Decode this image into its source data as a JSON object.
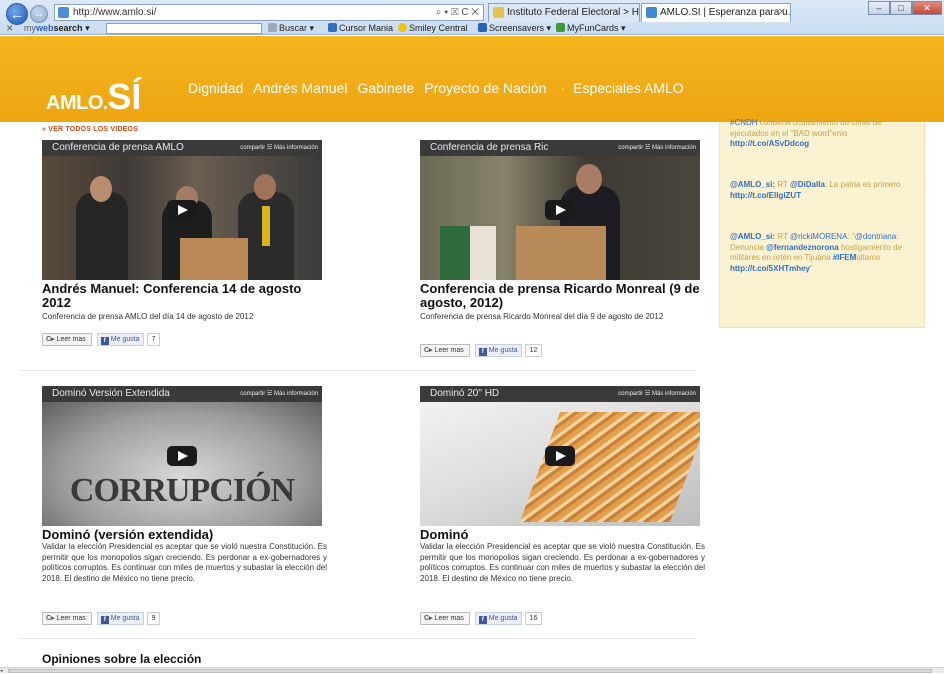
{
  "browser": {
    "address": "http://www.amlo.si/",
    "address_controls": "⌕ ▾ ☒ C ✕",
    "tabs": [
      {
        "label": "Instituto Federal Electoral > Ho...",
        "active": false,
        "icon_color": "#e7c24a"
      },
      {
        "label": "AMLO.SI | Esperanza para u...",
        "active": true,
        "icon_color": "#3f88d4"
      }
    ],
    "tab_close": "✕",
    "window_controls": {
      "minimize": "–",
      "maximize": "□",
      "close": "✕"
    },
    "back_icon": "←",
    "forward_icon": "→",
    "home_star": "⌂ ☆"
  },
  "toolbar": {
    "close_x": "✕",
    "brand_my": "my",
    "brand_web": "web",
    "brand_search": "search",
    "brand_caret": "▾",
    "buscar": "Buscar",
    "cursor_mania": "Cursor Mania",
    "smiley_central": "Smiley Central",
    "screensavers": "Screensavers",
    "myfuncards": "MyFunCards",
    "caret": "▾"
  },
  "header": {
    "logo_text": "AMLO",
    "logo_dot": ".",
    "logo_si": "SÍ",
    "nav": [
      "Dignidad",
      "Andrés Manuel",
      "Gabinete",
      "Proyecto de Nación"
    ],
    "nav_sep": "·",
    "nav_special": "Especiales AMLO",
    "color": "#f0a816"
  },
  "main": {
    "ver_todos": "» VER TODOS LOS VIDEOS",
    "share_label": "compartir",
    "share_icon": "☱",
    "more_info": "Más información",
    "leer_mas": "Leer mas",
    "leer_icon": "C▸",
    "me_gusta": "Me gusta",
    "fb_f": "f",
    "videos": [
      {
        "video_title": "Conferencia de prensa AMLO",
        "title": "Andrés Manuel: Conferencia 14 de agosto 2012",
        "desc": "Conferencia de prensa AMLO del día 14 de agosto de 2012",
        "likes": "7"
      },
      {
        "video_title": "Conferencia de prensa Ric",
        "title": "Conferencia de prensa Ricardo Monreal (9 de agosto, 2012)",
        "desc": "Conferencia de prensa Ricardo Monreal del día 9 de agosto de 2012",
        "likes": "12"
      },
      {
        "video_title": "Dominó Versión Extendida",
        "scene_text": "CORRUPCIÓN",
        "title": "Dominó (versión extendida)",
        "desc": "Validar la elección Presidencial es aceptar que se violó nuestra Constitución. Es permitir que los monopolios sigan creciendo. Es perdonar a ex-gobernadores y políticos corruptos. Es continuar con miles de muertos y subastar la elección del 2018. El destino de México no tiene precio.",
        "likes": "9"
      },
      {
        "video_title": "Dominó 20\" HD",
        "title": "Dominó",
        "desc": "Validar la elección Presidencial es aceptar que se violó nuestra Constitución. Es permitir que los monopolios sigan creciendo. Es perdonar a ex-gobernadores y políticos corruptos. Es continuar con miles de muertos y subastar la elección del 2018. El destino de México no tiene precio.",
        "likes": "16"
      }
    ],
    "section_heading": "Opiniones sobre la elección"
  },
  "sidebar": {
    "tweets": [
      {
        "hashtag": "#CNDH",
        "text": " condena ocultamiento de cifras de ejecutados en el \"BAD word\"enio ",
        "link": "http://t.co/ASvDdcog"
      },
      {
        "user": "@AMLO_si:",
        "rt": " RT ",
        "mention": "@DiDalla",
        "text": ": La patria es primero ",
        "link": "http://t.co/EllgiZUT"
      },
      {
        "user": "@AMLO_si:",
        "rt": " RT ",
        "mention": "@rickiMORENA",
        "text1": ": \"",
        "mention2": "@dontriana",
        "text2": ": Denuncia ",
        "mention3": "@fernandeznorona",
        "text3": " hostigamiento de militares en retén en Tijuana ",
        "hashtag": "#IFEM",
        "text4": "últame ",
        "link": "http://t.co/5XHTmhey",
        "end": "\""
      }
    ]
  },
  "scroll_arrow": "◂"
}
